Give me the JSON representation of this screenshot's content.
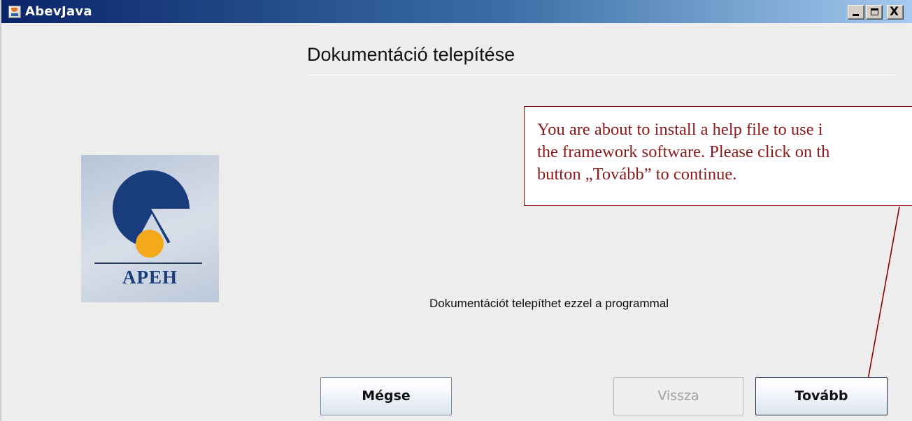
{
  "window": {
    "title": "AbevJava",
    "controls": [
      "minimize",
      "maximize",
      "close"
    ],
    "close_glyph": "X"
  },
  "page": {
    "title": "Dokumentáció telepítése",
    "description": "Dokumentációt telepíthet ezzel a programmal"
  },
  "logo": {
    "text": "APEH"
  },
  "callout": {
    "line1": "You are about to install a help file to use i",
    "line2": "the framework software. Please click on th",
    "line3": "button „Tovább” to continue."
  },
  "buttons": {
    "cancel_label": "Mégse",
    "back_label": "Vissza",
    "next_label": "Tovább"
  },
  "colors": {
    "titlebar_start": "#0a246a",
    "titlebar_end": "#a6caf0",
    "annotation": "#8b0000",
    "logo_blue": "#183c7c",
    "logo_orange": "#f4a81c"
  }
}
